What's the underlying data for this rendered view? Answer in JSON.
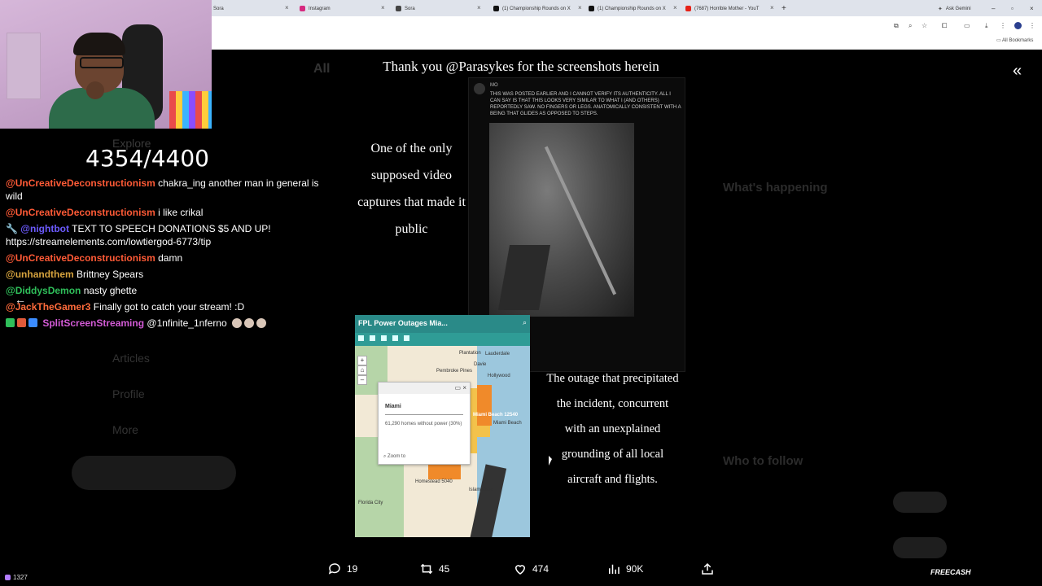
{
  "browser": {
    "tabs": [
      {
        "label": "Sora",
        "icon": "tab-icon",
        "color": "#888888"
      },
      {
        "label": "Instagram",
        "icon": "instagram-icon",
        "color": "#d6297f"
      },
      {
        "label": "Sora",
        "icon": "sora-icon",
        "color": "#444444"
      },
      {
        "label": "(1) Championship Rounds on X",
        "icon": "x-icon",
        "color": "#111111"
      },
      {
        "label": "(1) Championship Rounds on X",
        "icon": "x-icon",
        "color": "#111111"
      },
      {
        "label": "(7687) Horrible Mother - YouT",
        "icon": "youtube-icon",
        "color": "#e62117"
      }
    ],
    "ask_gemini": "Ask Gemini",
    "bookmarks": "All Bookmarks"
  },
  "stream": {
    "counter": "4354/4400",
    "viewers": "1327",
    "chat": [
      {
        "user": "@UnCreativeDeconstructionism",
        "text": "chakra_ing another man in general is wild",
        "color": "#ff5a36"
      },
      {
        "user": "@UnCreativeDeconstructionism",
        "text": "i like crikal",
        "color": "#ff5a36"
      },
      {
        "user": "@nightbot",
        "text": "TEXT TO SPEECH DONATIONS $5 AND UP! https://streamelements.com/lowtiergod-6773/tip",
        "color": "#6c5bff"
      },
      {
        "user": "@UnCreativeDeconstructionism",
        "text": "damn",
        "color": "#ff5a36"
      },
      {
        "user": "@unhandthem",
        "text": "Brittney Spears",
        "color": "#d6a33e"
      },
      {
        "user": "@DiddysDemon",
        "text": "nasty ghette",
        "color": "#2fbf5a"
      },
      {
        "user": "@JackTheGamer3",
        "text": "Finally got to catch your stream! :D",
        "color": "#ff6b3b"
      },
      {
        "user": "SplitScreenStreaming",
        "text": "@1nfinite_1nferno",
        "color": "#d35bd6"
      }
    ]
  },
  "media": {
    "thanks": "Thank you @Parasykes for the screenshots herein",
    "caption1": "One of the only supposed video captures that made it public",
    "caption2": "The outage that precipitated the incident, concurrent with an unexplained grounding of all local aircraft and flights.",
    "post": {
      "user": "MO",
      "text": "This was posted earlier and I cannot verify its authenticity. All I can say is that this looks very similar to what I (and others) reportedly saw. No fingers or legs. Anatomically consistent with a being that glides as opposed to steps."
    },
    "map": {
      "title": "FPL Power Outages Mia...",
      "popup_city": "Miami",
      "popup_desc": "61,290 homes without power (30%)",
      "zoom_to": "Zoom to",
      "labels": [
        "Plantation",
        "Lauderdale",
        "Pembroke Pines",
        "Davie",
        "Hollywood",
        "Miami Beach 12540",
        "Miami Beach",
        "Homestead 5040",
        "Islamorada",
        "Florida City"
      ]
    }
  },
  "engagement": {
    "replies": "19",
    "reposts": "45",
    "likes": "474",
    "views": "90K"
  },
  "overlay": {
    "freecash": "FREECASH"
  }
}
